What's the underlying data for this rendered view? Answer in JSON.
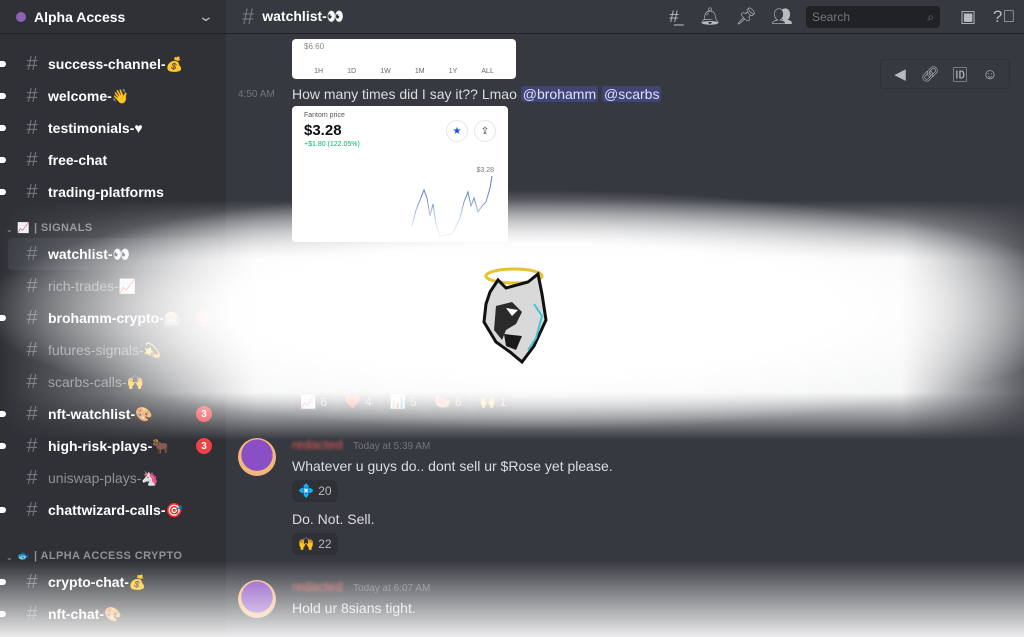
{
  "server": {
    "name": "Alpha Access"
  },
  "sidebar": {
    "channels_top": [
      {
        "name": "success-channel-💰",
        "unread": true
      },
      {
        "name": "welcome-👋",
        "unread": true
      },
      {
        "name": "testimonials-♥",
        "unread": true
      },
      {
        "name": "free-chat",
        "unread": true
      },
      {
        "name": "trading-platforms",
        "unread": true
      }
    ],
    "category_signals": {
      "emoji": "📈",
      "label": "| SIGNALS"
    },
    "channels_signals": [
      {
        "name": "watchlist-👀",
        "active": true
      },
      {
        "name": "rich-trades-📈",
        "unread": false
      },
      {
        "name": "brohamm-crypto-🎰",
        "unread": true,
        "badge": "1"
      },
      {
        "name": "futures-signals-💫",
        "unread": false
      },
      {
        "name": "scarbs-calls-🙌",
        "unread": false
      },
      {
        "name": "nft-watchlist-🎨",
        "unread": true,
        "badge": "3"
      },
      {
        "name": "high-risk-plays-🐂",
        "unread": true,
        "badge": "3"
      },
      {
        "name": "uniswap-plays-🦄",
        "unread": false
      },
      {
        "name": "chattwizard-calls-🎯",
        "unread": true
      }
    ],
    "category_crypto": {
      "emoji": "🐟",
      "label": "| ALPHA ACCESS CRYPTO"
    },
    "channels_crypto": [
      {
        "name": "crypto-chat-💰",
        "unread": true
      },
      {
        "name": "nft-chat-🎨",
        "unread": true
      }
    ]
  },
  "header": {
    "channel": "watchlist-👀"
  },
  "toolbar": {
    "icons": [
      "threads-icon",
      "bell-icon",
      "pin-icon",
      "members-icon"
    ],
    "search_placeholder": "Search"
  },
  "messages": {
    "card1": {
      "price_label": "$6.60",
      "ranges": [
        "1H",
        "1D",
        "1W",
        "1M",
        "1Y",
        "ALL"
      ]
    },
    "msg1": {
      "time": "4:50 AM",
      "text": "How many times did I say it?? Lmao",
      "mentions": [
        "@brohamm",
        "@scarbs"
      ]
    },
    "card2": {
      "label": "Fantom price",
      "price": "$3.28",
      "change": "+$1.80 (122.05%)",
      "high_label": "$3.28"
    },
    "reactions": [
      {
        "emoji": "📈",
        "count": "6"
      },
      {
        "emoji": "❤️",
        "count": "4"
      },
      {
        "emoji": "📊",
        "count": "5"
      },
      {
        "emoji": "🍉",
        "count": "6"
      },
      {
        "emoji": "🙌",
        "count": "1"
      }
    ],
    "group1": {
      "time": "Today at 5:39 AM",
      "text1": "Whatever u guys do.. dont sell ur $Rose yet please.",
      "reaction1": {
        "emoji": "💠",
        "count": "20"
      },
      "text2": "Do. Not. Sell.",
      "reaction2": {
        "emoji": "🙌",
        "count": "22"
      }
    },
    "group2": {
      "time": "Today at 6:07 AM",
      "text": "Hold ur 8sians tight."
    }
  }
}
